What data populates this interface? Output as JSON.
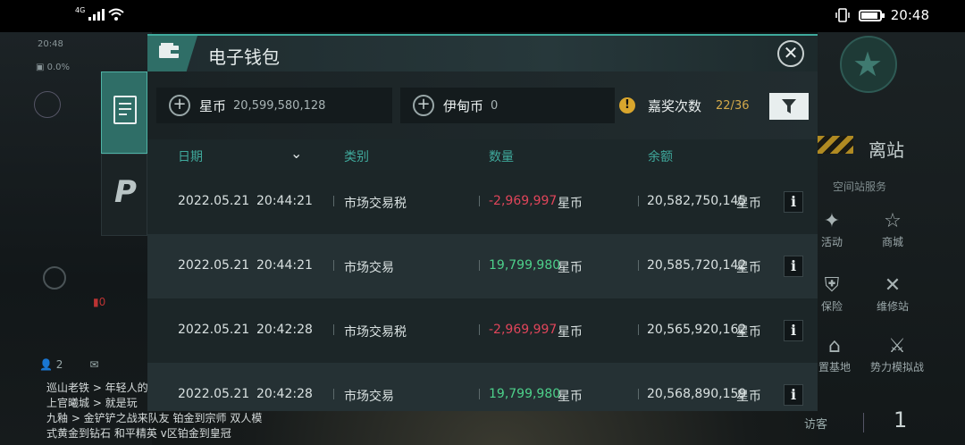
{
  "status_bar": {
    "network": "4G",
    "time": "20:48"
  },
  "background": {
    "clock": "20:48",
    "cube_value": "0.0%",
    "flag_count": "0",
    "friends_count": "2",
    "chat_lines": [
      "巡山老铁 > 年轻人的",
      "上官曦城 > 就是玩",
      "九釉 > 金铲铲之战来队友 铂金到宗师 双人模",
      "式黄金到钻石 和平精英 v区铂金到皇冠"
    ],
    "right_panel": {
      "station_label": "离站",
      "services_title": "空间站服务",
      "services": [
        "活动",
        "商城",
        "保险",
        "维修站",
        "置基地",
        "势力模拟战"
      ],
      "visitor_label": "访客",
      "visitor_count": "1"
    }
  },
  "wallet": {
    "title": "电子钱包",
    "currencies": [
      {
        "name": "星币",
        "amount": "20,599,580,128"
      },
      {
        "name": "伊甸币",
        "amount": "0"
      }
    ],
    "award": {
      "label": "嘉奖次数",
      "value": "22/36"
    },
    "columns": {
      "date": "日期",
      "category": "类别",
      "quantity": "数量",
      "balance": "余额"
    },
    "rows": [
      {
        "date": "2022.05.21",
        "time": "20:44:21",
        "category": "市场交易税",
        "amount": "-2,969,997",
        "unit": "星币",
        "balance": "20,582,750,145",
        "balance_unit": "星币",
        "sign": "neg"
      },
      {
        "date": "2022.05.21",
        "time": "20:44:21",
        "category": "市场交易",
        "amount": "19,799,980",
        "unit": "星币",
        "balance": "20,585,720,142",
        "balance_unit": "星币",
        "sign": "pos"
      },
      {
        "date": "2022.05.21",
        "time": "20:42:28",
        "category": "市场交易税",
        "amount": "-2,969,997",
        "unit": "星币",
        "balance": "20,565,920,162",
        "balance_unit": "星币",
        "sign": "neg"
      },
      {
        "date": "2022.05.21",
        "time": "20:42:28",
        "category": "市场交易",
        "amount": "19,799,980",
        "unit": "星币",
        "balance": "20,568,890,159",
        "balance_unit": "星币",
        "sign": "pos"
      }
    ]
  },
  "colors": {
    "accent": "#3fa99c",
    "negative": "#e0455a",
    "positive": "#4dd08a",
    "award": "#d2a84a"
  },
  "icons": [
    "wifi-icon",
    "signal-icon",
    "vibrate-icon",
    "battery-icon",
    "wallet-icon",
    "close-icon",
    "plus-icon",
    "warning-icon",
    "filter-icon",
    "document-icon",
    "p-logo-icon",
    "chevron-down-icon",
    "info-icon"
  ]
}
